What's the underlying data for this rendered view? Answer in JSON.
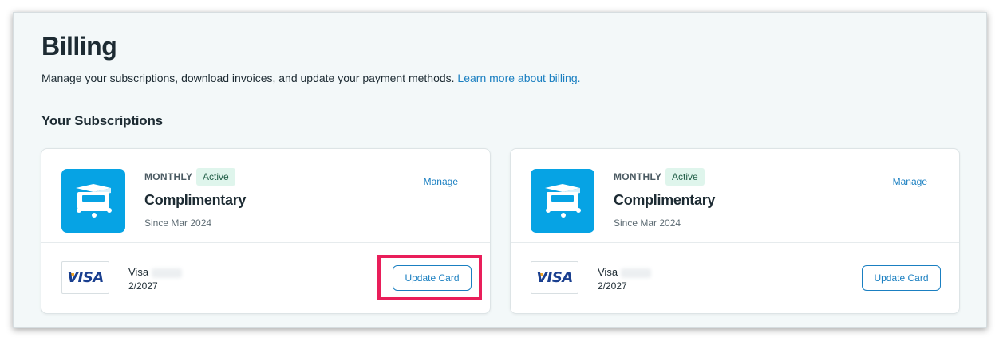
{
  "page": {
    "title": "Billing",
    "subtitle_text": "Manage your subscriptions, download invoices, and update your payment methods.",
    "subtitle_link": "Learn more about billing.",
    "section_title": "Your Subscriptions"
  },
  "subscriptions": [
    {
      "period": "MONTHLY",
      "status": "Active",
      "plan": "Complimentary",
      "since": "Since Mar 2024",
      "manage_label": "Manage",
      "card_logo": "VISA",
      "card_brand": "Visa",
      "card_expiry": "2/2027",
      "update_label": "Update Card",
      "highlighted": true
    },
    {
      "period": "MONTHLY",
      "status": "Active",
      "plan": "Complimentary",
      "since": "Since Mar 2024",
      "manage_label": "Manage",
      "card_logo": "VISA",
      "card_brand": "Visa",
      "card_expiry": "2/2027",
      "update_label": "Update Card",
      "highlighted": false
    }
  ],
  "icons": {
    "app": "cart-box-icon",
    "highlight_color": "#e91e5a",
    "accent": "#1a7fc1",
    "app_icon_bg": "#06a3e4"
  }
}
